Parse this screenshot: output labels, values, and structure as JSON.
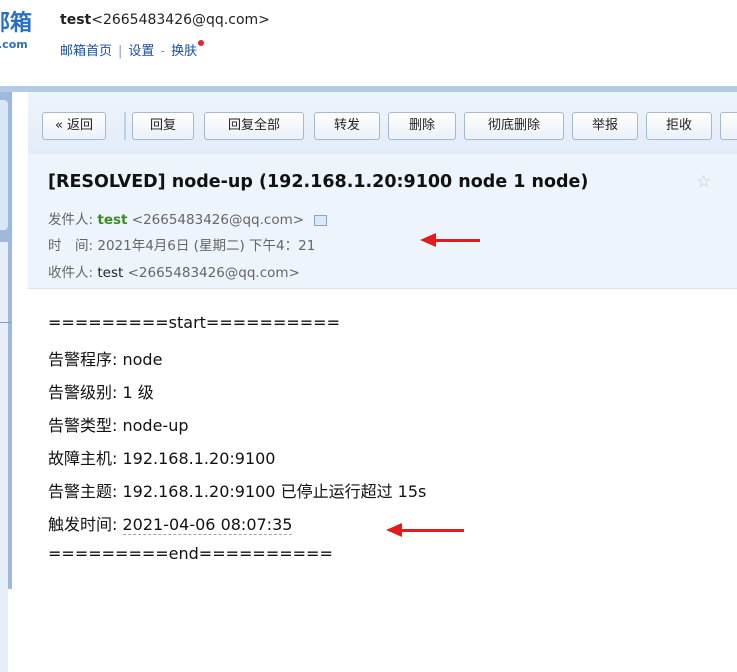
{
  "header": {
    "logo_big": "邮箱",
    "logo_small": ".com",
    "account_name": "test",
    "account_email": "<2665483426@qq.com>",
    "links": [
      "邮箱首页",
      "设置",
      "换肤"
    ],
    "sep1": "|",
    "sep2": "-"
  },
  "toolbar": {
    "buttons": [
      "« 返回",
      "回复",
      "回复全部",
      "转发",
      "删除",
      "彻底删除",
      "举报",
      "拒收",
      ""
    ]
  },
  "mail": {
    "subject": "[RESOLVED] node-up (192.168.1.20:9100 node 1 node)",
    "star": "☆",
    "from_label": "发件人:",
    "from_name": "test",
    "from_email": "<2665483426@qq.com>",
    "time_label": "时　间:",
    "time_value": "2021年4月6日 (星期二) 下午4：21",
    "to_label": "收件人:",
    "to_name": "test",
    "to_email": "<2665483426@qq.com>"
  },
  "body": {
    "start_line": "=========start==========",
    "rows": [
      {
        "label": "告警程序:",
        "value": "node"
      },
      {
        "label": "告警级别:",
        "value": "1 级"
      },
      {
        "label": "告警类型:",
        "value": "node-up"
      },
      {
        "label": "故障主机:",
        "value": "192.168.1.20:9100"
      },
      {
        "label": "告警主题:",
        "value": "192.168.1.20:9100 已停止运行超过 15s"
      },
      {
        "label": "触发时间:",
        "value": "2021-04-06 08:07:35"
      }
    ],
    "end_line": "=========end=========="
  },
  "colors": {
    "accent": "#2b6fc4",
    "arrow": "#e31b1b",
    "sender": "#3a8a2b"
  }
}
